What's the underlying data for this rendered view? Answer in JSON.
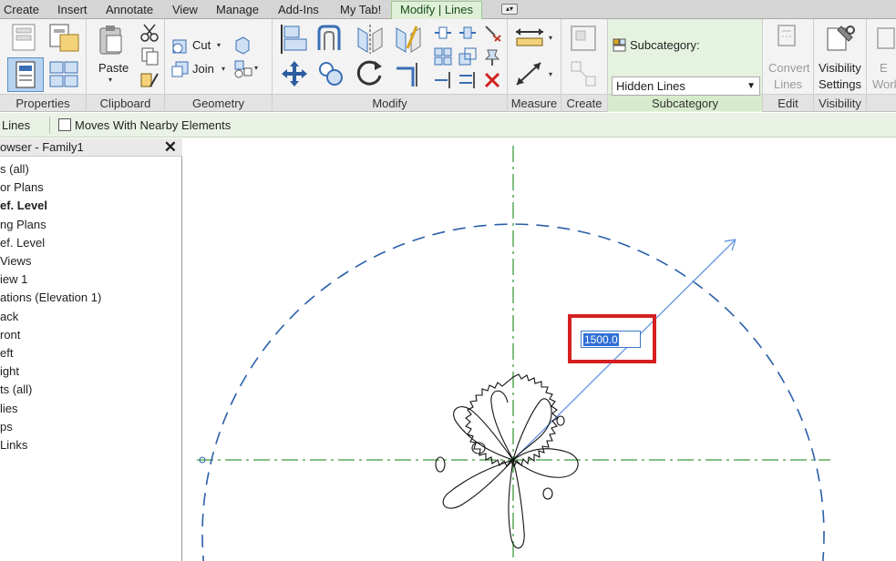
{
  "tabs": [
    {
      "label": "Create",
      "active": false
    },
    {
      "label": "Insert",
      "active": false
    },
    {
      "label": "Annotate",
      "active": false
    },
    {
      "label": "View",
      "active": false
    },
    {
      "label": "Manage",
      "active": false
    },
    {
      "label": "Add-Ins",
      "active": false
    },
    {
      "label": "My Tab!",
      "active": false
    },
    {
      "label": "Modify | Lines",
      "active": true
    }
  ],
  "ribbon": {
    "panels": {
      "properties": "Properties",
      "clipboard": "Clipboard",
      "geometry": "Geometry",
      "modify": "Modify",
      "measure": "Measure",
      "create": "Create",
      "subcategory": "Subcategory",
      "edit": "Edit",
      "visibility": "Visibility"
    },
    "paste_label": "Paste",
    "cut_label": "Cut",
    "join_label": "Join",
    "subcategory_label": "Subcategory:",
    "subcategory_value": "Hidden Lines",
    "convert_label_1": "Convert",
    "convert_label_2": "Lines",
    "visibility_label_1": "Visibility",
    "visibility_label_2": "Settings",
    "cutoff_label_1": "E",
    "cutoff_label_2": "Work"
  },
  "options_bar": {
    "lines_label": "Lines",
    "moves_with_label": "Moves With Nearby Elements",
    "moves_with_checked": false
  },
  "browser": {
    "title": "owser - Family1",
    "items": [
      {
        "label": "s (all)",
        "bold": false
      },
      {
        "label": "or Plans",
        "bold": false
      },
      {
        "label": "ef. Level",
        "bold": true
      },
      {
        "label": "ng Plans",
        "bold": false
      },
      {
        "label": "ef. Level",
        "bold": false
      },
      {
        "label": "Views",
        "bold": false
      },
      {
        "label": "iew 1",
        "bold": false
      },
      {
        "label": "ations (Elevation 1)",
        "bold": false
      },
      {
        "label": "ack",
        "bold": false
      },
      {
        "label": "ront",
        "bold": false
      },
      {
        "label": "eft",
        "bold": false
      },
      {
        "label": "ight",
        "bold": false
      },
      {
        "label": "ts (all)",
        "bold": false
      },
      {
        "label": "lies",
        "bold": false
      },
      {
        "label": "ps",
        "bold": false
      },
      {
        "label": " Links",
        "bold": false
      }
    ]
  },
  "canvas": {
    "dimension_value": "1500.0",
    "colors": {
      "circle": "#2a5fa8",
      "radius": "#6d9be0",
      "refplane": "#3c9a3c",
      "highlight": "#d42020"
    }
  }
}
